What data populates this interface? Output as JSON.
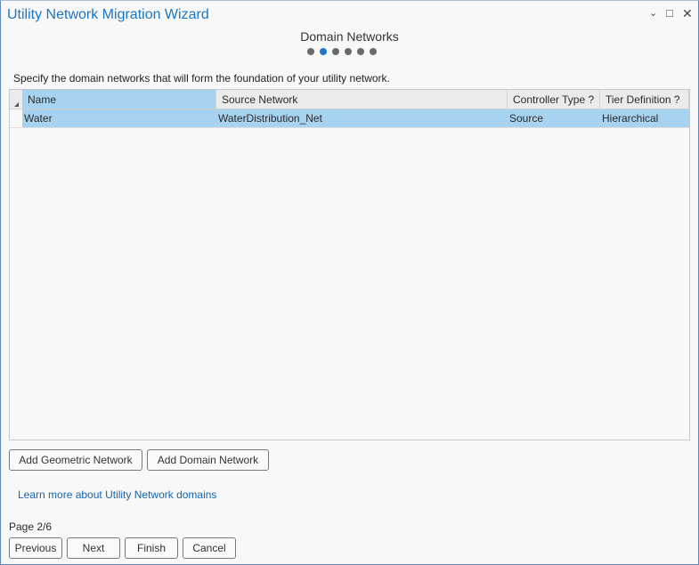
{
  "window": {
    "title": "Utility Network Migration Wizard"
  },
  "wizard": {
    "step_title": "Domain Networks",
    "total_steps": 6,
    "current_step": 2,
    "instructions": "Specify the domain networks that will form the foundation of your utility network."
  },
  "table": {
    "headers": [
      "Name",
      "Source Network",
      "Controller Type ?",
      "Tier Definition ?"
    ],
    "rows": [
      [
        "Water",
        "WaterDistribution_Net",
        "Source",
        "Hierarchical"
      ]
    ]
  },
  "buttons": {
    "add_geometric": "Add Geometric Network",
    "add_domain": "Add Domain Network",
    "previous": "Previous",
    "next": "Next",
    "finish": "Finish",
    "cancel": "Cancel"
  },
  "link": "Learn more about Utility Network domains",
  "page_indicator": "Page 2/6"
}
